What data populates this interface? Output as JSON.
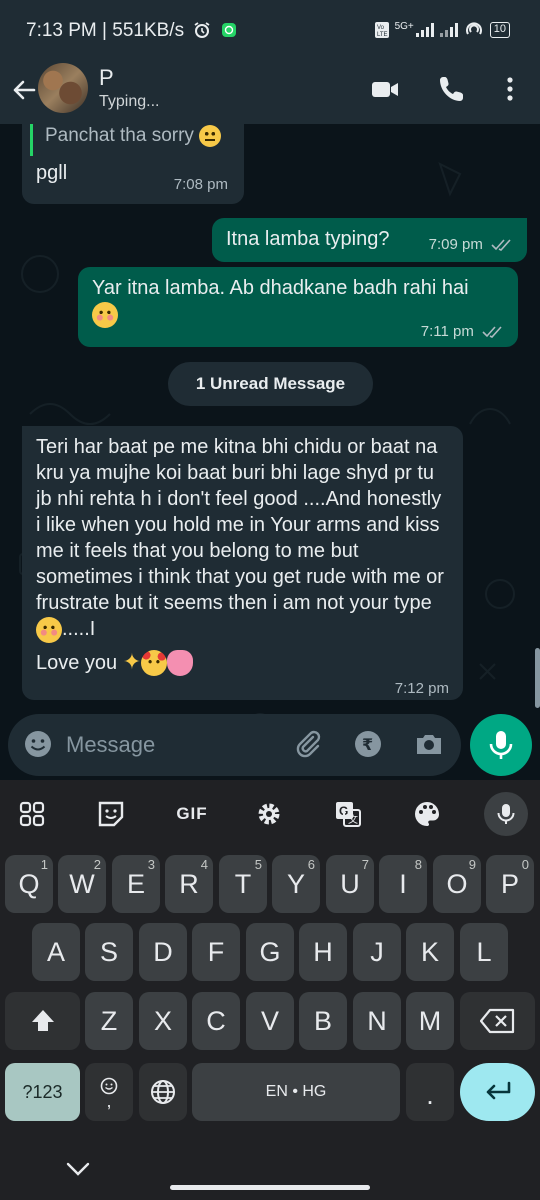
{
  "status_bar": {
    "time": "7:13 PM | 551KB/s",
    "network": "5G+",
    "battery": "10"
  },
  "header": {
    "contact_name": "P",
    "contact_status": "Typing..."
  },
  "messages": [
    {
      "direction": "incoming",
      "quote": "Panchat tha sorry",
      "text": "pgll",
      "time": "7:08 pm"
    },
    {
      "direction": "outgoing",
      "text": "Itna lamba typing?",
      "time": "7:09 pm",
      "status": "read"
    },
    {
      "direction": "outgoing",
      "text": "Yar itna lamba. Ab dhadkane badh rahi hai",
      "time": "7:11 pm",
      "status": "read"
    },
    {
      "direction": "incoming",
      "text": "Teri har baat pe me kitna bhi chidu or baat na kru ya mujhe koi baat buri bhi lage shyd pr tu jb nhi rehta h i don't feel good ....And honestly i like when you hold me in Your arms and kiss me it feels that you belong to me but sometimes i think that you get rude with me or frustrate but it seems then i am not your type",
      "text_tail": ".....I",
      "text2": "Love you",
      "time": "7:12 pm"
    }
  ],
  "unread_banner": "1 Unread Message",
  "compose": {
    "placeholder": "Message"
  },
  "keyboard": {
    "toolbar": [
      "apps-icon",
      "sticker-icon",
      "GIF",
      "settings-icon",
      "translate-icon",
      "palette-icon",
      "mic-icon"
    ],
    "row1": [
      [
        "Q",
        "1"
      ],
      [
        "W",
        "2"
      ],
      [
        "E",
        "3"
      ],
      [
        "R",
        "4"
      ],
      [
        "T",
        "5"
      ],
      [
        "Y",
        "6"
      ],
      [
        "U",
        "7"
      ],
      [
        "I",
        "8"
      ],
      [
        "O",
        "9"
      ],
      [
        "P",
        "0"
      ]
    ],
    "row2": [
      "A",
      "S",
      "D",
      "F",
      "G",
      "H",
      "J",
      "K",
      "L"
    ],
    "row3": [
      "Z",
      "X",
      "C",
      "V",
      "B",
      "N",
      "M"
    ],
    "symbols_key": "?123",
    "emoji_key_sub": ",",
    "space_label": "EN • HG",
    "period_key": "."
  },
  "colors": {
    "outgoing_bubble": "#005c4b",
    "incoming_bubble": "#1f2c34",
    "accent": "#00a884",
    "background": "#0b141a"
  }
}
